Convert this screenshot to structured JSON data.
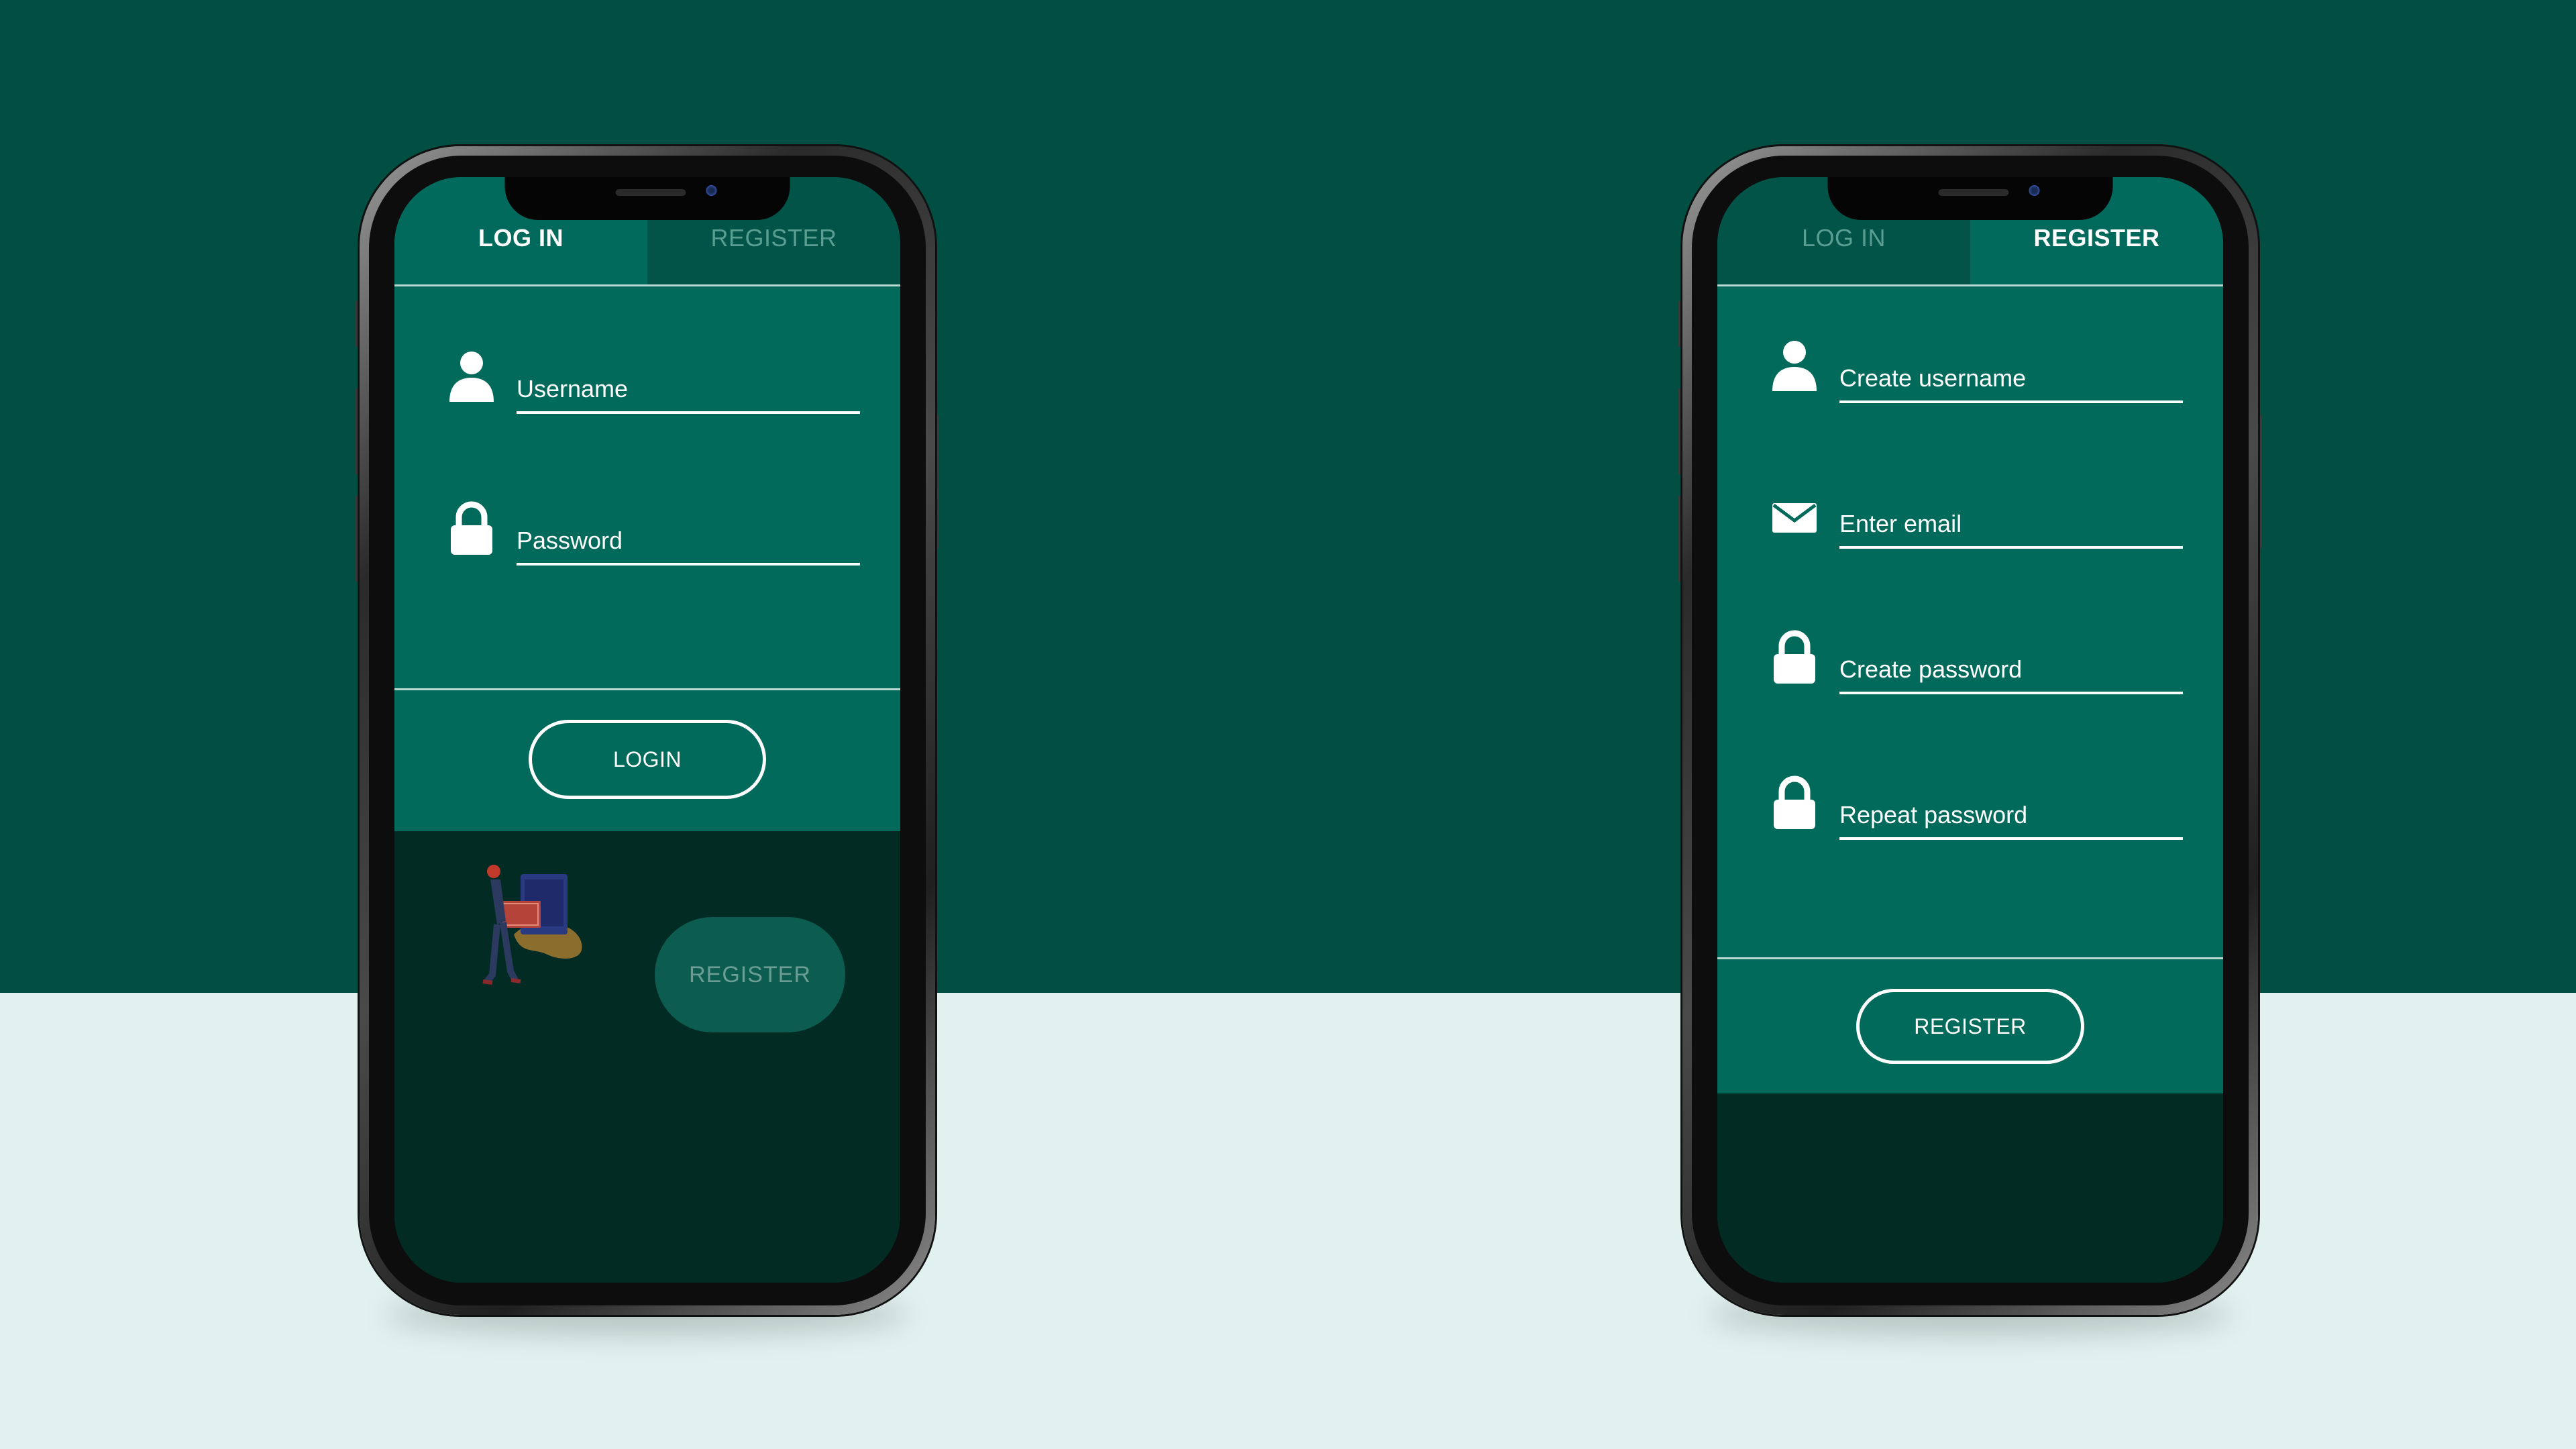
{
  "colors": {
    "bg_top": "#014f43",
    "bg_bottom": "#e1f1ef",
    "panel": "#016a5b",
    "dark": "#022b24",
    "text": "#ffffff"
  },
  "login_phone": {
    "tabs": {
      "login": "LOG IN",
      "register": "REGISTER"
    },
    "username_placeholder": "Username",
    "password_placeholder": "Password",
    "login_button": "LOGIN",
    "register_pill": "REGISTER",
    "icons": [
      "user-icon",
      "lock-icon"
    ]
  },
  "register_phone": {
    "tabs": {
      "login": "LOG IN",
      "register": "REGISTER"
    },
    "username_placeholder": "Create username",
    "email_placeholder": "Enter email",
    "password_placeholder": "Create password",
    "repeat_placeholder": "Repeat password",
    "register_button": "REGISTER",
    "icons": [
      "user-icon",
      "mail-icon",
      "lock-icon",
      "lock-icon"
    ]
  }
}
